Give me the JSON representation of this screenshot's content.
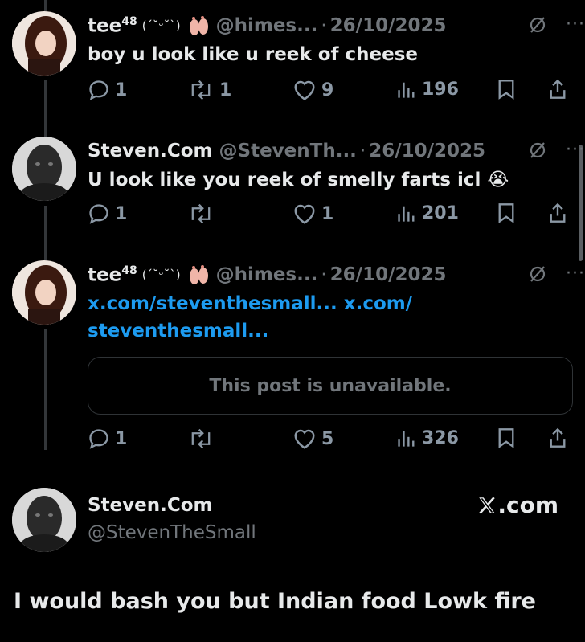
{
  "posts": [
    {
      "name": "tee",
      "sup": "48",
      "kaomoji": "(ˊ˘ᵕ˘ˋ)",
      "handle": "@himes...",
      "date": "26/10/2025",
      "text": "boy u look like u reek of cheese",
      "replies": "1",
      "reposts": "1",
      "likes": "9",
      "views": "196"
    },
    {
      "name": "Steven.Com",
      "handle": "@StevenTh...",
      "date": "26/10/2025",
      "text": "U look like you reek of smelly farts icl 😭",
      "replies": "1",
      "reposts": "",
      "likes": "1",
      "views": "201"
    },
    {
      "name": "tee",
      "sup": "48",
      "kaomoji": "(ˊ˘ᵕ˘ˋ)",
      "handle": "@himes...",
      "date": "26/10/2025",
      "link_line1": "x.com/steventhesmall... x.com/",
      "link_line2": "steventhesmall...",
      "unavailable": "This post is unavailable.",
      "replies": "1",
      "reposts": "",
      "likes": "5",
      "views": "326"
    }
  ],
  "quote": {
    "name": "Steven.Com",
    "handle": "@StevenTheSmall",
    "brand": ".com"
  },
  "caption": "I would bash you but Indian food Lowk fire",
  "separator": "·",
  "more": "···",
  "colors": {
    "link": "#1d9bf0",
    "muted": "#71767b",
    "text": "#e7e9ea",
    "bg": "#000000"
  }
}
